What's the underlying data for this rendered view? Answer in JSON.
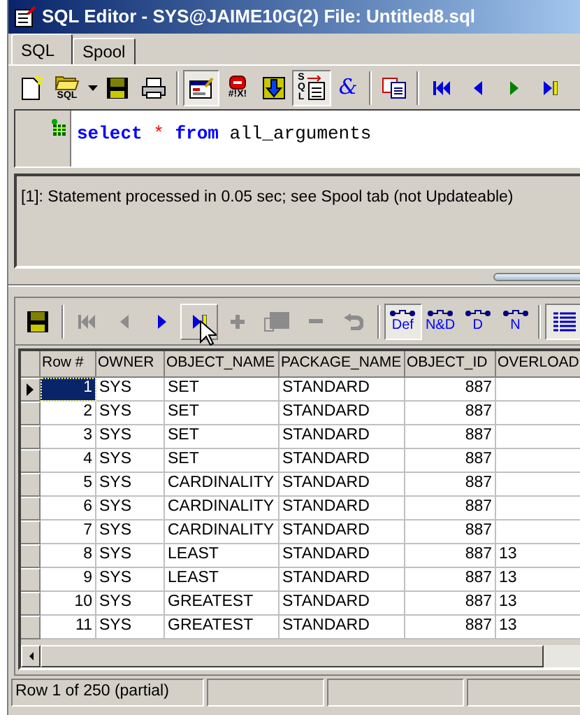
{
  "window": {
    "title": "SQL Editor - SYS@JAIME10G(2) File: Untitled8.sql"
  },
  "tabs": [
    {
      "label": "SQL",
      "selected": true
    },
    {
      "label": "Spool",
      "selected": false
    }
  ],
  "toolbar": [
    {
      "kind": "new",
      "pressed": false
    },
    {
      "kind": "open",
      "label": "SQL",
      "pressed": false
    },
    {
      "kind": "dropdown",
      "pressed": false
    },
    {
      "kind": "save",
      "pressed": false
    },
    {
      "kind": "print",
      "pressed": false
    },
    {
      "kind": "separator"
    },
    {
      "kind": "form",
      "pressed": true
    },
    {
      "kind": "error",
      "label": "#!X!",
      "pressed": false
    },
    {
      "kind": "download",
      "pressed": false
    },
    {
      "kind": "sqldoc",
      "label": "SQL",
      "pressed": true
    },
    {
      "kind": "ampersand",
      "label": "&",
      "pressed": false
    },
    {
      "kind": "separator"
    },
    {
      "kind": "copy",
      "pressed": false
    },
    {
      "kind": "separator"
    },
    {
      "kind": "first",
      "pressed": false
    },
    {
      "kind": "prior",
      "pressed": false
    },
    {
      "kind": "next",
      "pressed": false
    },
    {
      "kind": "last",
      "pressed": false
    }
  ],
  "editor": {
    "tokens": [
      {
        "text": "select",
        "kind": "keyword"
      },
      {
        "text": "*",
        "kind": "operator"
      },
      {
        "text": "from",
        "kind": "keyword"
      },
      {
        "text": "all_arguments",
        "kind": "plain"
      }
    ]
  },
  "message": "[1]: Statement processed in 0.05 sec; see Spool tab (not Updateable)",
  "grid_toolbar": [
    {
      "kind": "save",
      "disabled": false,
      "pressed": false
    },
    {
      "kind": "separator"
    },
    {
      "kind": "first",
      "disabled": true,
      "pressed": false
    },
    {
      "kind": "prior",
      "disabled": true,
      "pressed": false
    },
    {
      "kind": "next",
      "disabled": false,
      "pressed": false
    },
    {
      "kind": "last",
      "disabled": false,
      "pressed": true
    },
    {
      "kind": "insert",
      "disabled": true,
      "pressed": false
    },
    {
      "kind": "edit",
      "disabled": true,
      "pressed": false
    },
    {
      "kind": "delete",
      "disabled": true,
      "pressed": false
    },
    {
      "kind": "undo",
      "disabled": true,
      "pressed": false
    },
    {
      "kind": "separator"
    },
    {
      "kind": "mode",
      "label": "Def",
      "disabled": false,
      "pressed": true
    },
    {
      "kind": "mode",
      "label": "N&D",
      "disabled": false,
      "pressed": false
    },
    {
      "kind": "mode",
      "label": "D",
      "disabled": false,
      "pressed": false
    },
    {
      "kind": "mode",
      "label": "N",
      "disabled": false,
      "pressed": false
    },
    {
      "kind": "separator"
    },
    {
      "kind": "grid",
      "disabled": false,
      "pressed": true
    }
  ],
  "table": {
    "columns": [
      "Row #",
      "OWNER",
      "OBJECT_NAME",
      "PACKAGE_NAME",
      "OBJECT_ID",
      "OVERLOAD"
    ],
    "rows": [
      {
        "selected": true,
        "cells": [
          "1",
          "SYS",
          "SET",
          "STANDARD",
          "887",
          ""
        ]
      },
      {
        "selected": false,
        "cells": [
          "2",
          "SYS",
          "SET",
          "STANDARD",
          "887",
          ""
        ]
      },
      {
        "selected": false,
        "cells": [
          "3",
          "SYS",
          "SET",
          "STANDARD",
          "887",
          ""
        ]
      },
      {
        "selected": false,
        "cells": [
          "4",
          "SYS",
          "SET",
          "STANDARD",
          "887",
          ""
        ]
      },
      {
        "selected": false,
        "cells": [
          "5",
          "SYS",
          "CARDINALITY",
          "STANDARD",
          "887",
          ""
        ]
      },
      {
        "selected": false,
        "cells": [
          "6",
          "SYS",
          "CARDINALITY",
          "STANDARD",
          "887",
          ""
        ]
      },
      {
        "selected": false,
        "cells": [
          "7",
          "SYS",
          "CARDINALITY",
          "STANDARD",
          "887",
          ""
        ]
      },
      {
        "selected": false,
        "cells": [
          "8",
          "SYS",
          "LEAST",
          "STANDARD",
          "887",
          "13"
        ]
      },
      {
        "selected": false,
        "cells": [
          "9",
          "SYS",
          "LEAST",
          "STANDARD",
          "887",
          "13"
        ]
      },
      {
        "selected": false,
        "cells": [
          "10",
          "SYS",
          "GREATEST",
          "STANDARD",
          "887",
          "13"
        ]
      },
      {
        "selected": false,
        "cells": [
          "11",
          "SYS",
          "GREATEST",
          "STANDARD",
          "887",
          "13"
        ]
      }
    ]
  },
  "status_bar": {
    "text": "Row 1 of 250 (partial)"
  }
}
